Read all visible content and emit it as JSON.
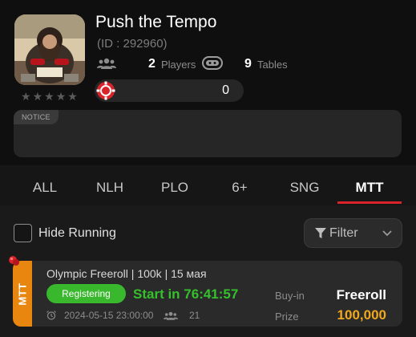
{
  "club": {
    "name": "Push the Tempo",
    "id_text": "(ID : 292960)",
    "players_count": "2",
    "players_label": "Players",
    "tables_count": "9",
    "tables_label": "Tables",
    "chip_value": "0",
    "rating_stars": 0,
    "notice_label": "NOTICE",
    "notice_text": ""
  },
  "tabs": [
    {
      "label": "ALL",
      "active": false
    },
    {
      "label": "NLH",
      "active": false
    },
    {
      "label": "PLO",
      "active": false
    },
    {
      "label": "6+",
      "active": false
    },
    {
      "label": "SNG",
      "active": false
    },
    {
      "label": "MTT",
      "active": true
    }
  ],
  "filters": {
    "hide_running_label": "Hide Running",
    "hide_running_checked": false,
    "filter_label": "Filter"
  },
  "tournament": {
    "game_type": "MTT",
    "title": "Olympic Freeroll | 100k | 15 мая",
    "status": "Registering",
    "start_in": "Start in 76:41:57",
    "datetime": "2024-05-15 23:00:00",
    "entrants": "21",
    "buyin_label": "Buy-in",
    "buyin_value": "Freeroll",
    "prize_label": "Prize",
    "prize_value": "100,000"
  },
  "colors": {
    "accent_red": "#d8232a",
    "registering_green": "#39b82e",
    "prize_gold": "#f0a81e",
    "mtt_orange": "#e8860f"
  }
}
